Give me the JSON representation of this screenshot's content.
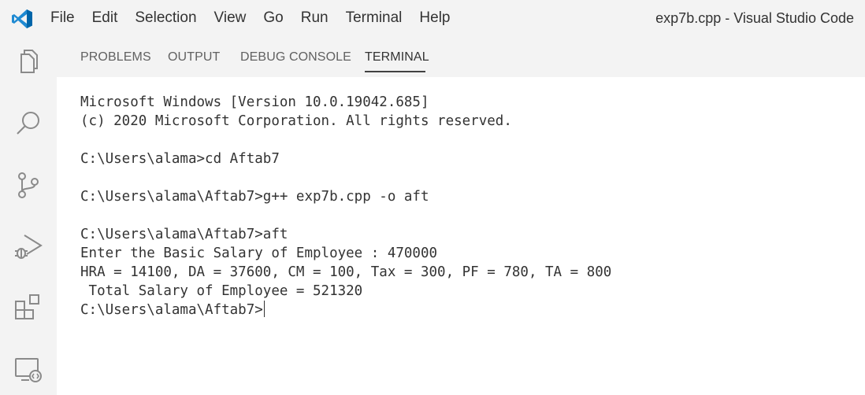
{
  "titlebar": {
    "menu": [
      "File",
      "Edit",
      "Selection",
      "View",
      "Go",
      "Run",
      "Terminal",
      "Help"
    ],
    "window_title": "exp7b.cpp - Visual Studio Code"
  },
  "activity_bar": {
    "icons": [
      "explorer-icon",
      "search-icon",
      "source-control-icon",
      "run-debug-icon",
      "extensions-icon",
      "remote-explorer-icon"
    ]
  },
  "panel": {
    "tabs": [
      "PROBLEMS",
      "OUTPUT",
      "DEBUG CONSOLE",
      "TERMINAL"
    ],
    "active_tab": "TERMINAL"
  },
  "terminal": {
    "lines": [
      "Microsoft Windows [Version 10.0.19042.685]",
      "(c) 2020 Microsoft Corporation. All rights reserved.",
      "",
      "C:\\Users\\alama>cd Aftab7",
      "",
      "C:\\Users\\alama\\Aftab7>g++ exp7b.cpp -o aft",
      "",
      "C:\\Users\\alama\\Aftab7>aft",
      "Enter the Basic Salary of Employee : 470000",
      "HRA = 14100, DA = 37600, CM = 100, Tax = 300, PF = 780, TA = 800",
      " Total Salary of Employee = 521320"
    ],
    "prompt": "C:\\Users\\alama\\Aftab7>"
  }
}
